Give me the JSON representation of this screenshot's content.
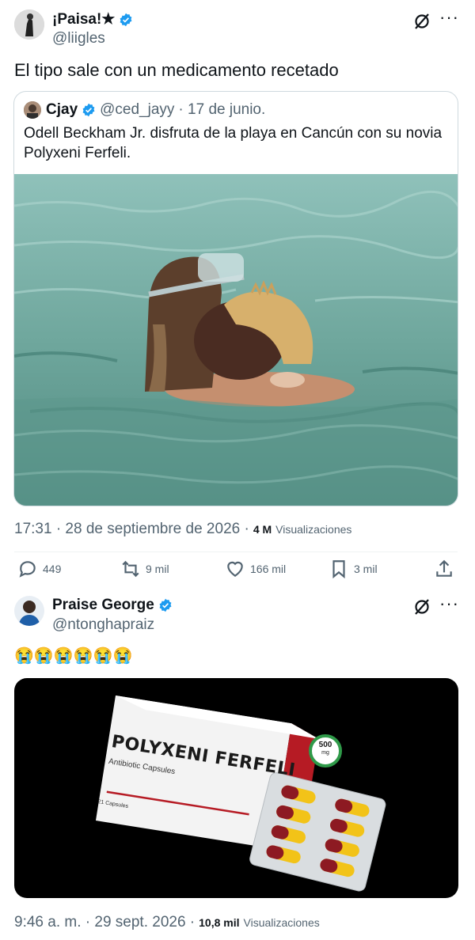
{
  "tweet1": {
    "display_name": "¡Paisa!★",
    "handle": "@liigles",
    "text": "El tipo sale con un medicamento recetado",
    "quote": {
      "display_name": "Cjay",
      "handle": "@ced_jayy",
      "date": "· 17 de junio.",
      "text": "Odell Beckham Jr. disfruta de la playa en Cancún con su novia Polyxeni Ferfeli."
    },
    "timestamp": "17:31 · 28 de septiembre de 2026 ·",
    "views_count": "4 M",
    "views_label": "Visualizaciones",
    "actions": {
      "replies": "449",
      "reposts": "9 mil",
      "likes": "166 mil",
      "bookmarks": "3 mil"
    }
  },
  "tweet2": {
    "display_name": "Praise George",
    "handle": "@ntonghapraiz",
    "text": "😭😭😭😭😭😭",
    "image": {
      "brand": "POLYXENI FERFELI",
      "subtitle": "Antibiotic Capsules",
      "count": "21 Capsules",
      "dose_value": "500",
      "dose_unit": "mg"
    },
    "timestamp": "9:46 a. m. · 29 sept. 2026 ·",
    "views_count": "10,8 mil",
    "views_label": "Visualizaciones"
  },
  "colors": {
    "verified": "#1d9bf0",
    "text": "#0f1419",
    "muted": "#536471",
    "border": "#cfd9de"
  }
}
